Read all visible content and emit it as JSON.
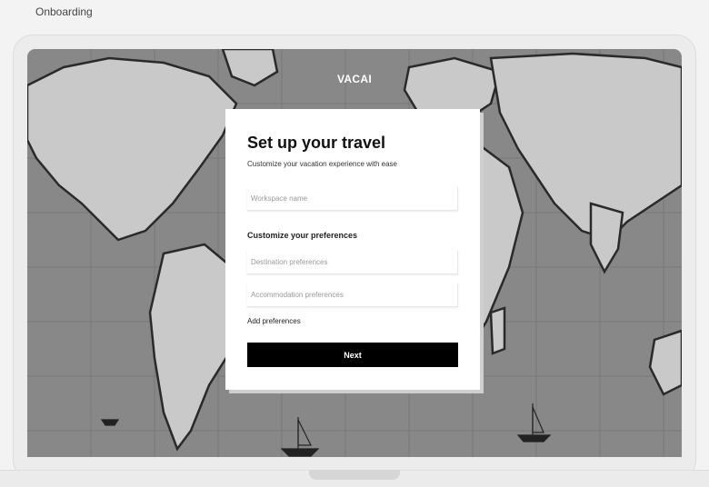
{
  "page": {
    "label": "Onboarding"
  },
  "brand": {
    "name": "VACAI"
  },
  "card": {
    "title": "Set up your travel",
    "subtitle": "Customize your vacation experience with ease",
    "workspace_placeholder": "Workspace name",
    "preferences_heading": "Customize your preferences",
    "destination_placeholder": "Destination preferences",
    "accommodation_placeholder": "Accommodation preferences",
    "add_preferences_label": "Add preferences",
    "next_label": "Next"
  },
  "colors": {
    "primary_button": "#000000",
    "card_background": "#ffffff",
    "map_tone": "#8a8a8a"
  }
}
